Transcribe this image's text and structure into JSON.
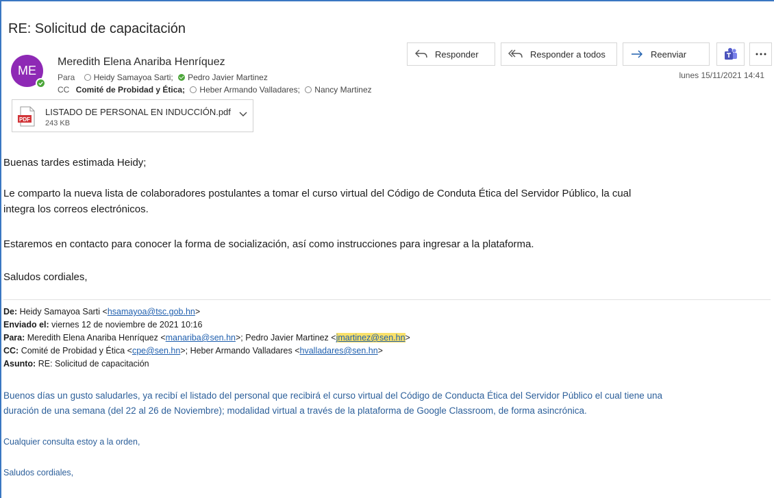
{
  "email": {
    "subject": "RE: Solicitud de capacitación",
    "avatar_initials": "ME",
    "avatar_color": "#8e29b5",
    "sender_name": "Meredith Elena Anariba Henríquez",
    "to_label": "Para",
    "to": [
      "Heidy Samayoa Sarti;",
      "Pedro Javier Martinez"
    ],
    "cc_label": "CC",
    "cc": [
      "Comité de Probidad y Ética;",
      "Heber Armando Valladares;",
      "Nancy Martinez"
    ],
    "date": "lunes 15/11/2021 14:41",
    "actions": {
      "reply": "Responder",
      "reply_all": "Responder a todos",
      "forward": "Reenviar"
    },
    "attachment": {
      "name": "LISTADO DE PERSONAL EN INDUCCIÓN.pdf",
      "size": "243 KB",
      "icon_label": "PDF"
    },
    "body": {
      "greeting": "Buenas tardes estimada Heidy;",
      "p1_line1": "Le comparto la nueva lista de colaboradores postulantes  a tomar el curso virtual del Código de Conduta Ética del Servidor Público, la cual",
      "p1_line2": "integra los correos electrónicos.",
      "p2": "Estaremos en contacto para conocer la forma de socialización, así como instrucciones para ingresar a la plataforma.",
      "closing": "Saludos cordiales,"
    },
    "quoted": {
      "from_label": "De:",
      "from_name": "Heidy Samayoa Sarti <",
      "from_email": "hsamayoa@tsc.gob.hn",
      "from_end": ">",
      "sent_label": "Enviado el:",
      "sent_value": "viernes 12 de noviembre de 2021 10:16",
      "to_label": "Para:",
      "to_name1": "Meredith Elena Anariba Henríquez <",
      "to_email1": "manariba@sen.hn",
      "to_mid": ">; Pedro Javier Martinez <",
      "to_email2": "jmartinez@sen.hn",
      "to_end": ">",
      "cc_label": "CC:",
      "cc_name1": "Comité de Probidad y Ética <",
      "cc_email1": "cpe@sen.hn",
      "cc_mid": ">; Heber Armando Valladares <",
      "cc_email2": "hvalladares@sen.hn",
      "cc_end": ">",
      "subject_label": "Asunto:",
      "subject_value": "RE: Solicitud de capacitación",
      "body_line1": "Buenos días un gusto saludarles, ya recibí el listado del personal que recibirá el curso virtual del Código de Conducta Ética del Servidor Público el cual tiene una",
      "body_line2": "duración de una semana (del 22 al 26 de Noviembre); modalidad virtual a través de la plataforma de Google Classroom, de forma asincrónica.",
      "body_line3": "Cualquier consulta estoy a la orden,",
      "body_line4": "Saludos cordiales,"
    }
  }
}
